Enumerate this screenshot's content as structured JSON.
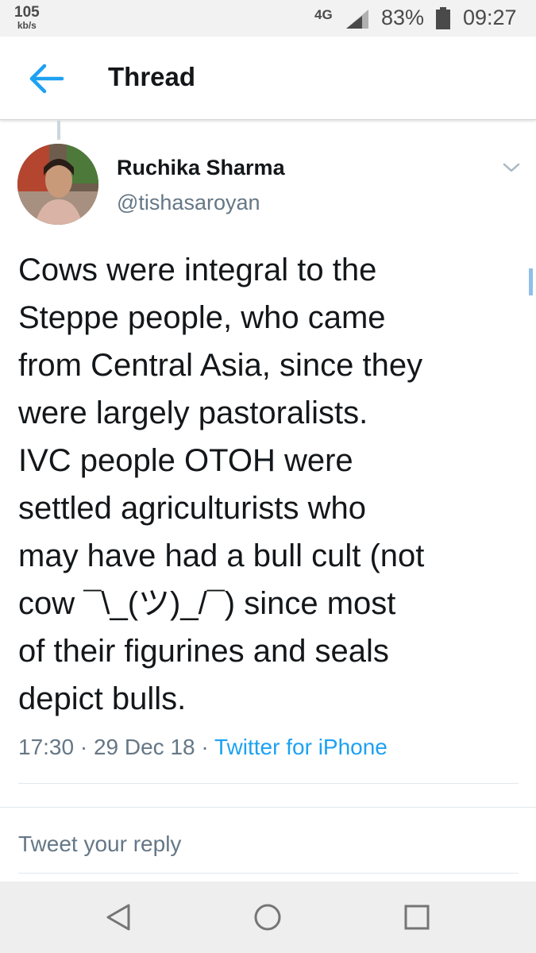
{
  "status_bar": {
    "net_speed": "105",
    "net_speed_unit": "kb/s",
    "network_type": "4G",
    "battery": "83%",
    "time": "09:27"
  },
  "header": {
    "title": "Thread"
  },
  "tweet": {
    "author_name": "Ruchika Sharma",
    "author_handle": "@tishasaroyan",
    "text": "Cows were integral to the\nSteppe people, who came\nfrom Central Asia, since they\nwere largely pastoralists.\nIVC people OTOH were\nsettled agriculturists who\nmay have had a bull cult (not\ncow ¯\\_(ツ)_/¯) since most\nof their figurines and seals\ndepict bulls.",
    "time": "17:30",
    "date": "29 Dec 18",
    "source": "Twitter for iPhone"
  },
  "reply": {
    "placeholder": "Tweet your reply"
  },
  "colors": {
    "accent": "#1da1f2",
    "text_primary": "#14171a",
    "text_secondary": "#657786"
  }
}
